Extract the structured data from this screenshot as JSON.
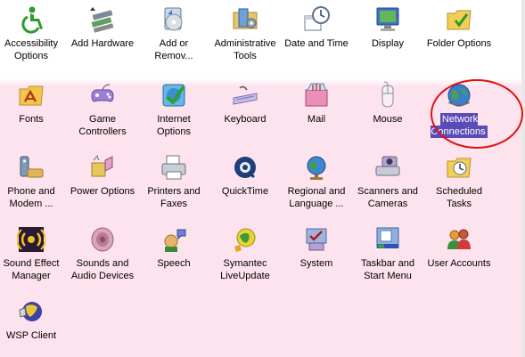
{
  "control_panel": {
    "items": [
      {
        "label": "Accessibility\nOptions",
        "icon": "accessibility-icon"
      },
      {
        "label": "Add Hardware",
        "icon": "add-hardware-icon"
      },
      {
        "label": "Add or\nRemov...",
        "icon": "add-remove-programs-icon"
      },
      {
        "label": "Administrative\nTools",
        "icon": "administrative-tools-icon"
      },
      {
        "label": "Date and Time",
        "icon": "date-time-icon"
      },
      {
        "label": "Display",
        "icon": "display-icon"
      },
      {
        "label": "Folder Options",
        "icon": "folder-options-icon"
      },
      {
        "label": "Fonts",
        "icon": "fonts-folder-icon"
      },
      {
        "label": "Game\nControllers",
        "icon": "game-controller-icon"
      },
      {
        "label": "Internet\nOptions",
        "icon": "internet-options-icon"
      },
      {
        "label": "Keyboard",
        "icon": "keyboard-icon"
      },
      {
        "label": "Mail",
        "icon": "mail-icon"
      },
      {
        "label": "Mouse",
        "icon": "mouse-icon"
      },
      {
        "label": "Network\nConnections",
        "icon": "network-connections-icon",
        "selected": true
      },
      {
        "label": "Phone and\nModem ...",
        "icon": "phone-modem-icon"
      },
      {
        "label": "Power Options",
        "icon": "power-options-icon"
      },
      {
        "label": "Printers and\nFaxes",
        "icon": "printer-icon"
      },
      {
        "label": "QuickTime",
        "icon": "quicktime-icon"
      },
      {
        "label": "Regional and\nLanguage ...",
        "icon": "globe-icon"
      },
      {
        "label": "Scanners and\nCameras",
        "icon": "scanner-camera-icon"
      },
      {
        "label": "Scheduled\nTasks",
        "icon": "scheduled-tasks-icon"
      },
      {
        "label": "Sound Effect\nManager",
        "icon": "sound-effect-icon"
      },
      {
        "label": "Sounds and\nAudio Devices",
        "icon": "speaker-icon"
      },
      {
        "label": "Speech",
        "icon": "speech-icon"
      },
      {
        "label": "Symantec\nLiveUpdate",
        "icon": "liveupdate-icon"
      },
      {
        "label": "System",
        "icon": "system-icon"
      },
      {
        "label": "Taskbar and\nStart Menu",
        "icon": "taskbar-icon"
      },
      {
        "label": "User Accounts",
        "icon": "user-accounts-icon"
      },
      {
        "label": "WSP Client",
        "icon": "wsp-client-icon"
      }
    ]
  },
  "colors": {
    "background_pink": "#fde3ee",
    "selection": "#5b4bb7",
    "annotation_circle": "#e01010"
  }
}
